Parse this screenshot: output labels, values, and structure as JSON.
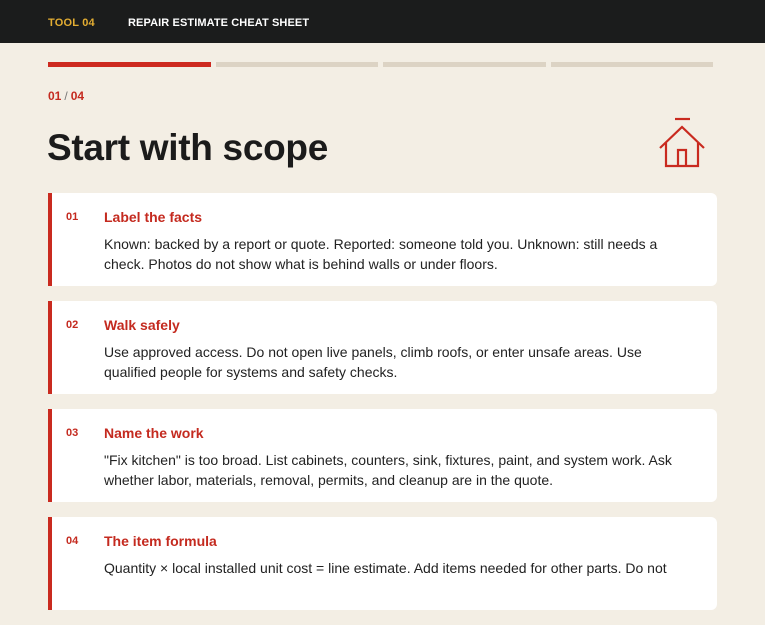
{
  "header": {
    "tool_label": "TOOL 04",
    "sheet_title": "REPAIR ESTIMATE CHEAT SHEET"
  },
  "progress": {
    "current_step": 1,
    "total_steps": 4
  },
  "step_counter": {
    "current": "01",
    "separator": "/",
    "total": "04"
  },
  "page_title": "Start with scope",
  "icon": "house-icon",
  "colors": {
    "accent": "#c92a1f",
    "topbar": "#1b1c1c",
    "tool_label": "#e3ad32",
    "background": "#f3eee4"
  },
  "cards": [
    {
      "num": "01",
      "title": "Label the facts",
      "body": "Known: backed by a report or quote. Reported: someone told you. Unknown: still needs a check. Photos do not show what is behind walls or under floors."
    },
    {
      "num": "02",
      "title": "Walk safely",
      "body": "Use approved access. Do not open live panels, climb roofs, or enter unsafe areas. Use qualified people for systems and safety checks."
    },
    {
      "num": "03",
      "title": "Name the work",
      "body": "\"Fix kitchen\" is too broad. List cabinets, counters, sink, fixtures, paint, and system work. Ask whether labor, materials, removal, permits, and cleanup are in the quote."
    },
    {
      "num": "04",
      "title": "The item formula",
      "body": "Quantity × local installed unit cost = line estimate. Add items needed for other parts. Do not"
    }
  ]
}
